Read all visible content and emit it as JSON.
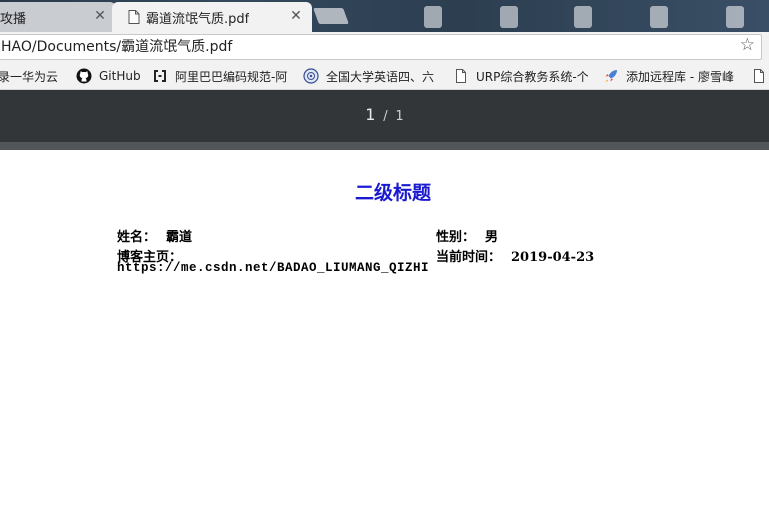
{
  "tabs": {
    "inactive": {
      "title": "攻播"
    },
    "active": {
      "title": "霸道流氓气质.pdf"
    },
    "close_glyph": "✕"
  },
  "address_bar": {
    "url": "HAO/Documents/霸道流氓气质.pdf"
  },
  "bookmarks": [
    {
      "label": "录一华为云",
      "icon": "cloud-icon"
    },
    {
      "label": "GitHub",
      "icon": "github-icon"
    },
    {
      "label": "阿里巴巴编码规范-阿",
      "icon": "alibaba-icon"
    },
    {
      "label": "全国大学英语四、六",
      "icon": "cet-seal-icon"
    },
    {
      "label": "URP综合教务系统-个",
      "icon": "page-icon"
    },
    {
      "label": "添加远程库 - 廖雪峰",
      "icon": "rocket-icon"
    }
  ],
  "pdf_toolbar": {
    "current_page": "1",
    "separator": "/",
    "total_pages": "1"
  },
  "document": {
    "title": "二级标题",
    "name_label": "姓名：",
    "name_value": "霸道",
    "gender_label": "性别：",
    "gender_value": "男",
    "blog_label": "博客主页：",
    "blog_url": "https://me.csdn.net/BADAO_LIUMANG_QIZHI",
    "time_label": "当前时间：",
    "time_value": "2019-04-23"
  },
  "colors": {
    "title_color": "#1a1ad0",
    "pdf_toolbar_bg": "#323639"
  }
}
